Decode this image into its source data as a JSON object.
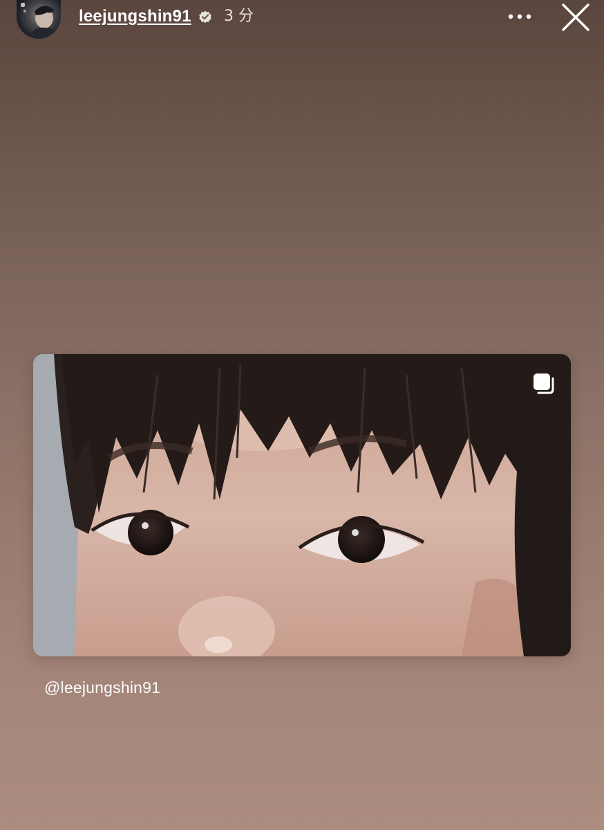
{
  "header": {
    "username": "leejungshin91",
    "timestamp": "3 分",
    "icons": {
      "avatar": "profile-avatar",
      "verified": "verified-badge-icon",
      "more": "more-options-icon",
      "close": "close-icon"
    }
  },
  "post": {
    "icons": {
      "carousel": "multiple-photos-icon"
    },
    "mention": "@leejungshin91"
  },
  "colors": {
    "background_top": "#5a463e",
    "background_bottom": "#ac8d80",
    "text": "#ffffff"
  }
}
